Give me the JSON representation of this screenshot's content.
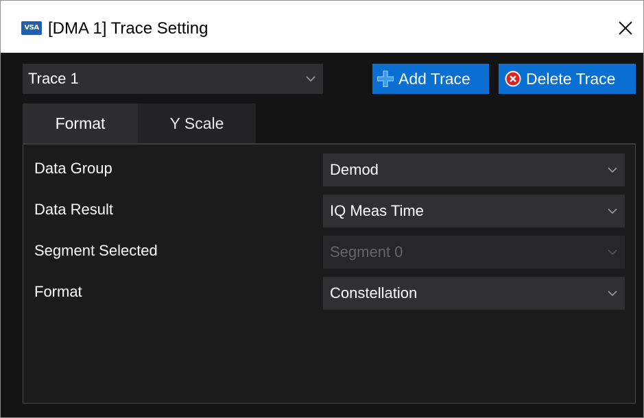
{
  "window": {
    "title": "[DMA 1] Trace Setting",
    "app_icon_text": "VSA",
    "close_glyph": "✕"
  },
  "trace_selector": {
    "value": "Trace 1"
  },
  "toolbar": {
    "add_label": "Add Trace",
    "delete_label": "Delete Trace"
  },
  "tabs": [
    {
      "label": "Format",
      "active": true
    },
    {
      "label": "Y Scale",
      "active": false
    }
  ],
  "format_panel": {
    "rows": [
      {
        "label": "Data Group",
        "value": "Demod",
        "enabled": true
      },
      {
        "label": "Data Result",
        "value": "IQ Meas Time",
        "enabled": true
      },
      {
        "label": "Segment Selected",
        "value": "Segment 0",
        "enabled": false
      },
      {
        "label": "Format",
        "value": "Constellation",
        "enabled": true
      }
    ]
  },
  "colors": {
    "accent": "#0a6fd0",
    "background": "#141414",
    "field": "#303032",
    "delete_icon": "#e02020"
  },
  "icons": {
    "app": "vsa-logo-icon",
    "close": "close-icon",
    "add": "plus-icon",
    "delete": "delete-circle-icon",
    "dropdown": "chevron-down-icon"
  }
}
